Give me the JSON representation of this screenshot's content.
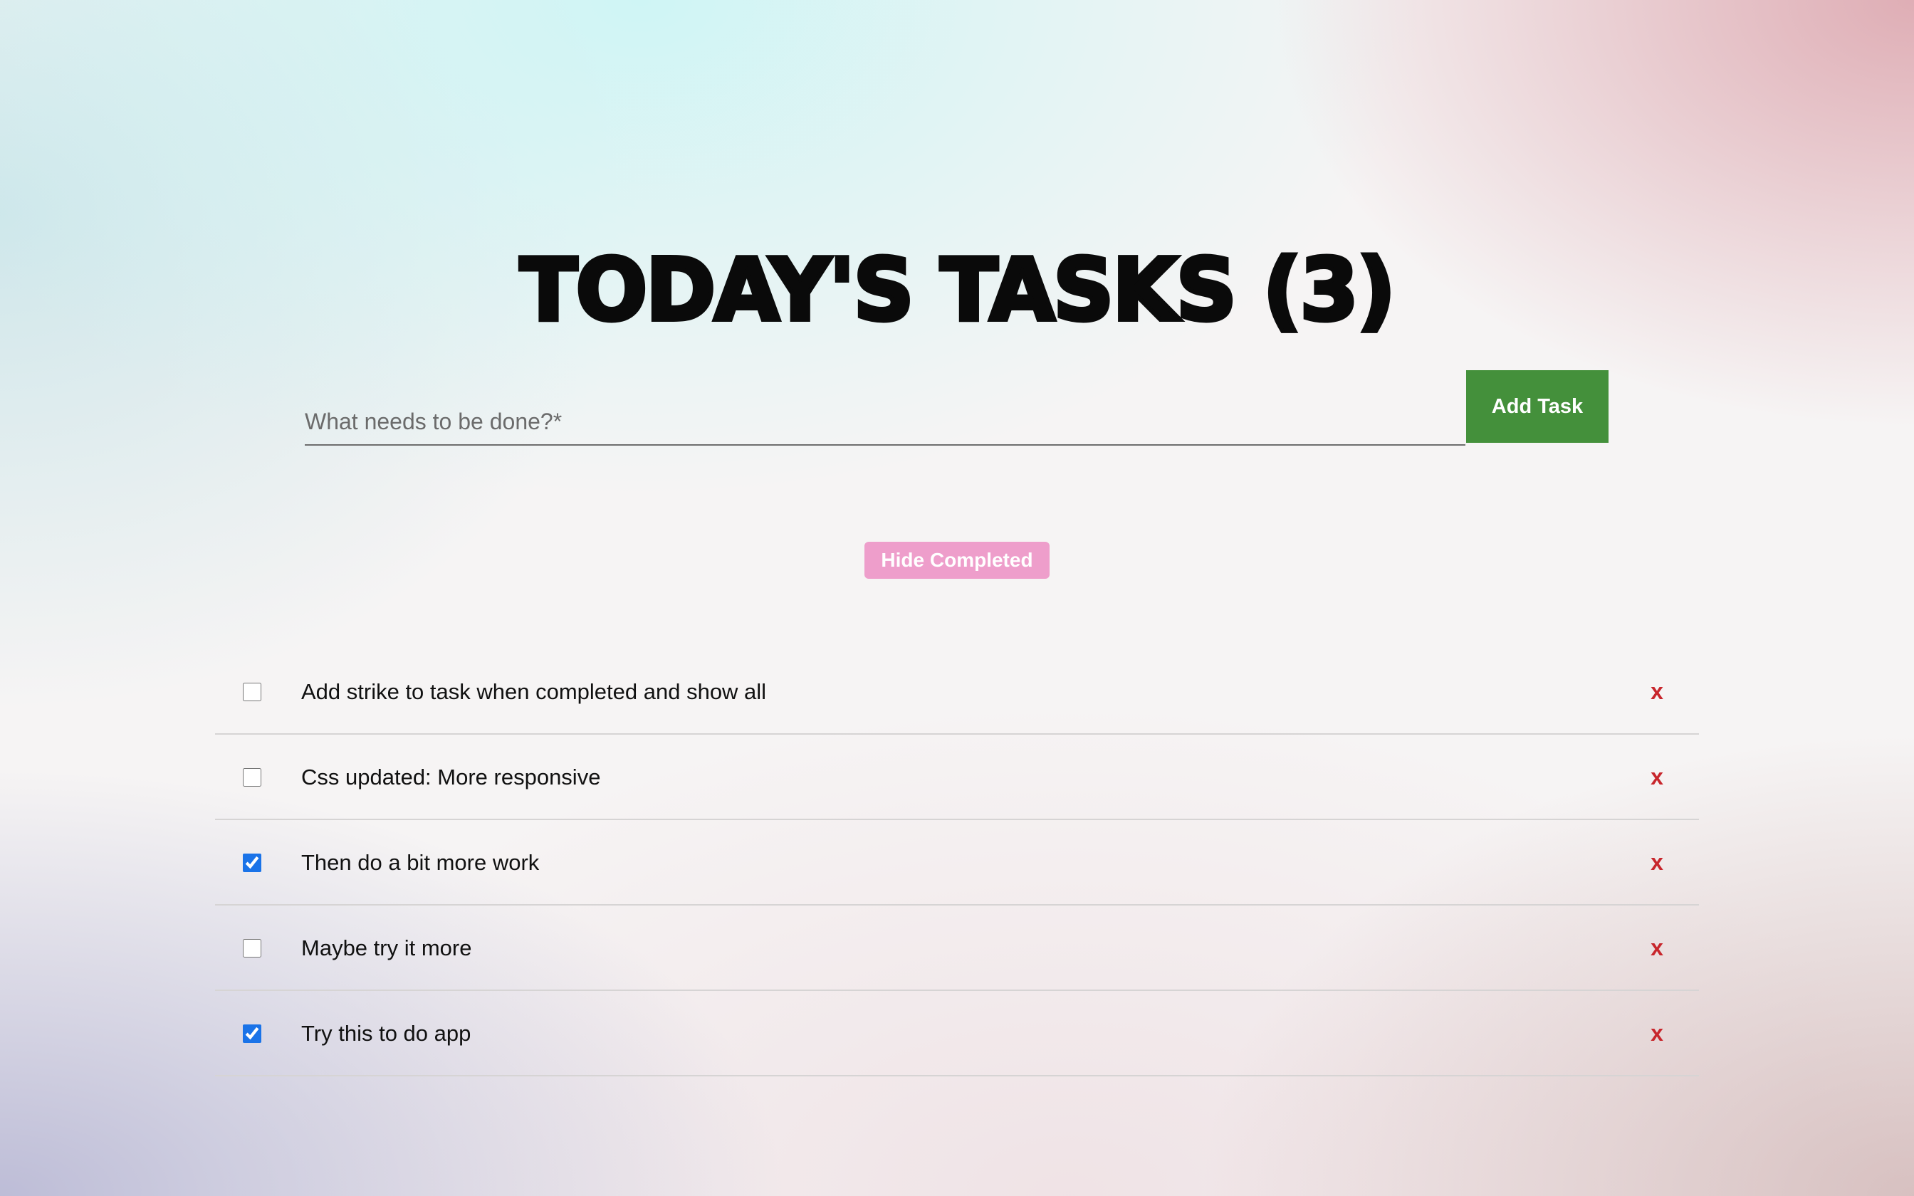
{
  "header": {
    "title": "Today's Tasks (3)"
  },
  "form": {
    "placeholder": "What needs to be done?*",
    "value": "",
    "add_label": "Add Task",
    "add_color": "#44903b"
  },
  "filter": {
    "hide_completed_label": "Hide Completed",
    "color": "#ee9ecb"
  },
  "tasks": [
    {
      "text": "Add strike to task when completed and show all",
      "checked": false,
      "delete_label": "x"
    },
    {
      "text": "Css updated: More responsive",
      "checked": false,
      "delete_label": "x"
    },
    {
      "text": "Then do a bit more work",
      "checked": true,
      "delete_label": "x"
    },
    {
      "text": "Maybe try it more",
      "checked": false,
      "delete_label": "x"
    },
    {
      "text": "Try this to do app",
      "checked": true,
      "delete_label": "x"
    }
  ],
  "colors": {
    "delete": "#c8262c",
    "checkbox_accent": "#1a73e8"
  }
}
